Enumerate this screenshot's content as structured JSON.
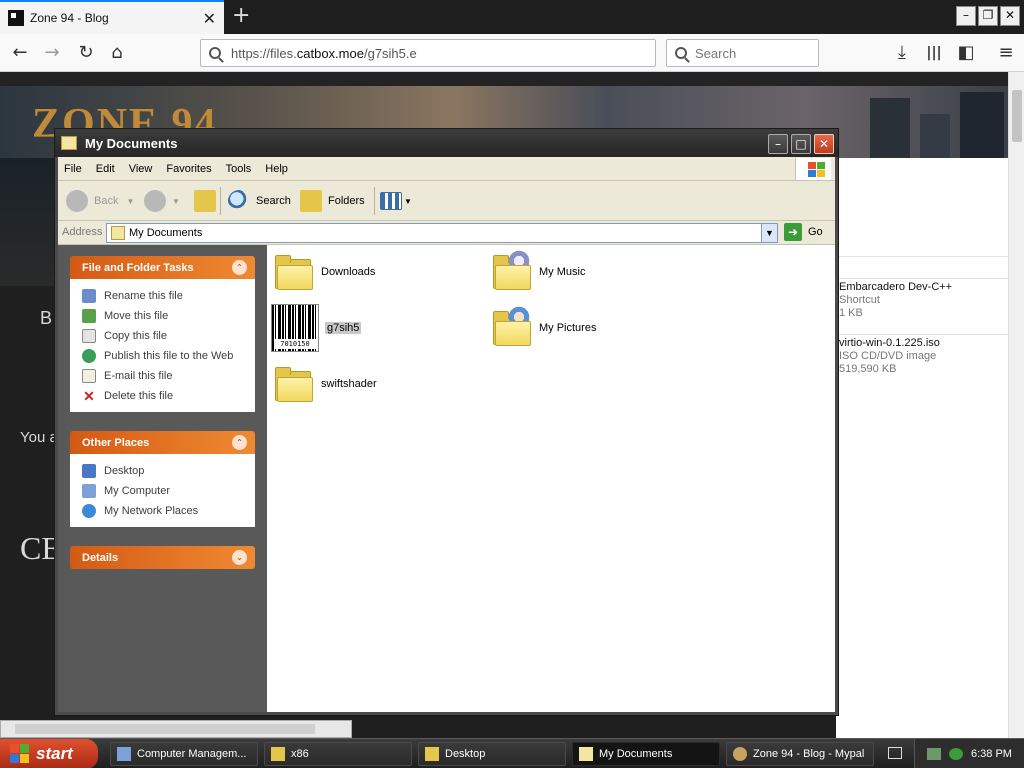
{
  "browser": {
    "tab_title": "Zone 94 - Blog",
    "tab_close": "✕",
    "new_tab": "+",
    "url_prefix": "https://files.",
    "url_domain": "catbox.moe",
    "url_path": "/g7sih5.e",
    "search_placeholder": "Search",
    "window_minimize": "–",
    "window_restore": "❐",
    "window_close": "✕"
  },
  "webpage": {
    "banner_logo": "ZONE 94",
    "side_letter": "B",
    "you_text": "You a",
    "heading_fragment": "CE",
    "files": [
      {
        "name": "Embarcadero Dev-C++",
        "type": "Shortcut",
        "size": "1 KB"
      },
      {
        "name": "virtio-win-0.1.225.iso",
        "type": "ISO CD/DVD image",
        "size": "519,590 KB"
      }
    ]
  },
  "explorer": {
    "title": "My Documents",
    "menu": [
      "File",
      "Edit",
      "View",
      "Favorites",
      "Tools",
      "Help"
    ],
    "toolbar": {
      "back": "Back",
      "search": "Search",
      "folders": "Folders"
    },
    "address_label": "Address",
    "address_value": "My Documents",
    "go_label": "Go",
    "file_tasks": {
      "title": "File and Folder Tasks",
      "items": [
        "Rename this file",
        "Move this file",
        "Copy this file",
        "Publish this file to the Web",
        "E-mail this file",
        "Delete this file"
      ]
    },
    "other_places": {
      "title": "Other Places",
      "items": [
        "Desktop",
        "My Computer",
        "My Network Places"
      ]
    },
    "details": {
      "title": "Details"
    },
    "files": [
      {
        "name": "Downloads"
      },
      {
        "name": "My Music"
      },
      {
        "name": "g7sih5",
        "barcode_caption": "7010150"
      },
      {
        "name": "My Pictures"
      },
      {
        "name": "swiftshader"
      }
    ]
  },
  "taskbar": {
    "start_label": "start",
    "items": [
      "Computer Managem...",
      "x86",
      "Desktop",
      "My Documents",
      "Zone 94 - Blog - Mypal"
    ],
    "clock": "6:38 PM"
  },
  "colors": {
    "task_header": "#e06c24",
    "firefox_accent": "#0a84ff",
    "xp_start": "#c23b1e"
  }
}
